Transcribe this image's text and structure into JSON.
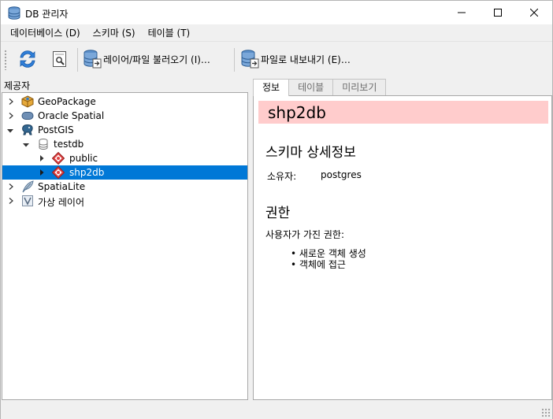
{
  "window": {
    "title": "DB 관리자",
    "icons": {
      "app": "database-icon",
      "minimize": "minimize-icon",
      "maximize": "maximize-icon",
      "close": "close-icon"
    }
  },
  "menubar": [
    {
      "label": "데이터베이스 (D)"
    },
    {
      "label": "스키마 (S)"
    },
    {
      "label": "테이블 (T)"
    }
  ],
  "toolbar": {
    "refresh_icon": "refresh-icon",
    "sql_icon": "sql-window-icon",
    "import_label": "레이어/파일 불러오기 (I)…",
    "export_label": "파일로 내보내기 (E)…"
  },
  "providers": {
    "title": "제공자",
    "items": [
      {
        "label": "GeoPackage",
        "icon": "geopackage-icon",
        "expanded": false
      },
      {
        "label": "Oracle Spatial",
        "icon": "oracle-icon",
        "expanded": false
      },
      {
        "label": "PostGIS",
        "icon": "postgis-elephant-icon",
        "expanded": true
      },
      {
        "label": "testdb",
        "icon": "database-icon",
        "expanded": true
      },
      {
        "label": "public",
        "icon": "schema-icon",
        "expanded": false
      },
      {
        "label": "shp2db",
        "icon": "schema-icon",
        "expanded": false,
        "selected": true
      },
      {
        "label": "SpatiaLite",
        "icon": "spatialite-feather-icon",
        "expanded": false
      },
      {
        "label": "가상 레이어",
        "icon": "virtual-layer-icon",
        "expanded": false
      }
    ]
  },
  "tabs": [
    {
      "label": "정보",
      "active": true
    },
    {
      "label": "테이블",
      "active": false
    },
    {
      "label": "미리보기",
      "active": false
    }
  ],
  "info": {
    "schema_name": "shp2db",
    "details_title": "스키마 상세정보",
    "owner_label": "소유자:",
    "owner_value": "postgres",
    "privileges_title": "권한",
    "privileges_text": "사용자가 가진 권한:",
    "privileges": [
      "새로운 객체 생성",
      "객체에 접근"
    ]
  },
  "colors": {
    "selection": "#0078d7",
    "heading_bar": "#ffcccc"
  }
}
